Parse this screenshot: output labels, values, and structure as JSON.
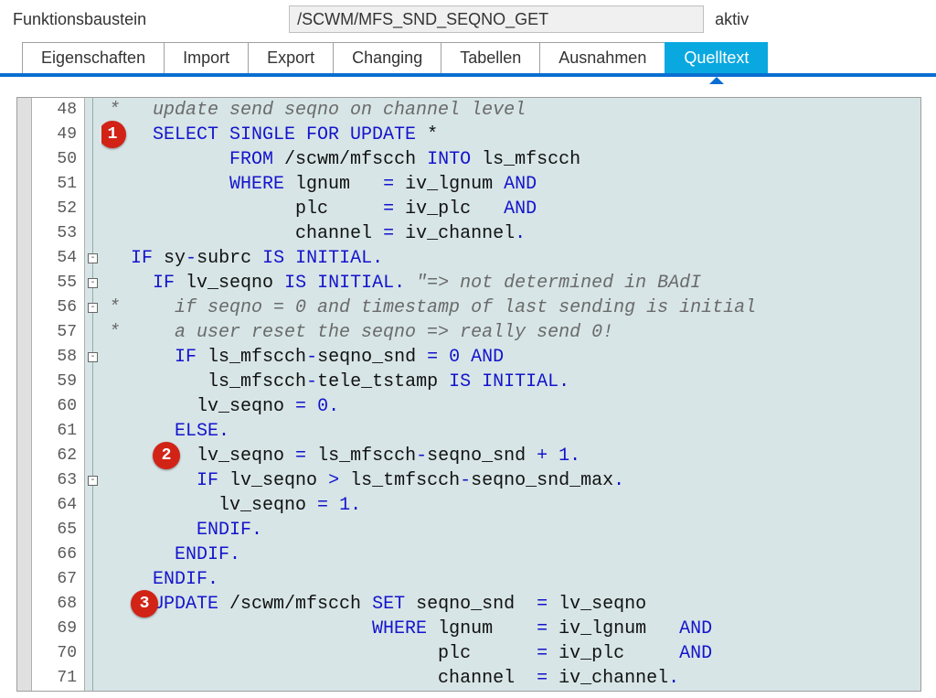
{
  "header": {
    "label": "Funktionsbaustein",
    "value": "/SCWM/MFS_SND_SEQNO_GET",
    "status": "aktiv"
  },
  "tabs": [
    {
      "label": "Eigenschaften",
      "active": false
    },
    {
      "label": "Import",
      "active": false
    },
    {
      "label": "Export",
      "active": false
    },
    {
      "label": "Changing",
      "active": false
    },
    {
      "label": "Tabellen",
      "active": false
    },
    {
      "label": "Ausnahmen",
      "active": false
    },
    {
      "label": "Quelltext",
      "active": true
    }
  ],
  "lines": [
    48,
    49,
    50,
    51,
    52,
    53,
    54,
    55,
    56,
    57,
    58,
    59,
    60,
    61,
    62,
    63,
    64,
    65,
    66,
    67,
    68,
    69,
    70,
    71
  ],
  "badges": [
    {
      "n": "1",
      "line": 49,
      "x": -3
    },
    {
      "n": "2",
      "line": 62,
      "x": 56
    },
    {
      "n": "3",
      "line": 68,
      "x": 32
    }
  ],
  "fold_glyphs": [
    {
      "line": 54,
      "sym": "⊟"
    },
    {
      "line": 55,
      "sym": "⊟"
    },
    {
      "line": 56,
      "sym": "⊟"
    },
    {
      "line": 58,
      "sym": "⊟"
    },
    {
      "line": 63,
      "sym": "⊟"
    }
  ],
  "code": [
    {
      "i": 48,
      "html": "<span class='cm'>*   update send seqno on channel level</span>"
    },
    {
      "i": 49,
      "html": "    <span class='kw'>SELECT SINGLE FOR UPDATE</span> *"
    },
    {
      "i": 50,
      "html": "           <span class='kw'>FROM</span> /scwm/mfscch <span class='kw'>INTO</span> ls_mfscch"
    },
    {
      "i": 51,
      "html": "           <span class='kw'>WHERE</span> lgnum   <span class='kw'>=</span> iv_lgnum <span class='kw'>AND</span>"
    },
    {
      "i": 52,
      "html": "                 plc     <span class='kw'>=</span> iv_plc   <span class='kw'>AND</span>"
    },
    {
      "i": 53,
      "html": "                 channel <span class='kw'>=</span> iv_channel<span class='kw'>.</span>"
    },
    {
      "i": 54,
      "html": "  <span class='kw'>IF</span> sy<span class='kw'>-</span>subrc <span class='kw'>IS INITIAL.</span>"
    },
    {
      "i": 55,
      "html": "    <span class='kw'>IF</span> lv_seqno <span class='kw'>IS INITIAL.</span> <span class='str'>\"=> not determined in BAdI</span>"
    },
    {
      "i": 56,
      "html": "<span class='cm'>*     if seqno = 0 and timestamp of last sending is initial</span>"
    },
    {
      "i": 57,
      "html": "<span class='cm'>*     a user reset the seqno => really send 0!</span>"
    },
    {
      "i": 58,
      "html": "      <span class='kw'>IF</span> ls_mfscch<span class='kw'>-</span>seqno_snd <span class='kw'>=</span> <span class='kw'>0</span> <span class='kw'>AND</span>"
    },
    {
      "i": 59,
      "html": "         ls_mfscch<span class='kw'>-</span>tele_tstamp <span class='kw'>IS INITIAL.</span>"
    },
    {
      "i": 60,
      "html": "        lv_seqno <span class='kw'>=</span> <span class='kw'>0.</span>"
    },
    {
      "i": 61,
      "html": "      <span class='kw'>ELSE.</span>"
    },
    {
      "i": 62,
      "html": "        lv_seqno <span class='kw'>=</span> ls_mfscch<span class='kw'>-</span>seqno_snd <span class='kw'>+</span> <span class='kw'>1.</span>"
    },
    {
      "i": 63,
      "html": "        <span class='kw'>IF</span> lv_seqno <span class='kw'>&gt;</span> ls_tmfscch<span class='kw'>-</span>seqno_snd_max<span class='kw'>.</span>"
    },
    {
      "i": 64,
      "html": "          lv_seqno <span class='kw'>=</span> <span class='kw'>1.</span>"
    },
    {
      "i": 65,
      "html": "        <span class='kw'>ENDIF.</span>"
    },
    {
      "i": 66,
      "html": "      <span class='kw'>ENDIF.</span>"
    },
    {
      "i": 67,
      "html": "    <span class='kw'>ENDIF.</span>"
    },
    {
      "i": 68,
      "html": "    <span class='kw'>UPDATE</span> /scwm/mfscch <span class='kw'>SET</span> seqno_snd  <span class='kw'>=</span> lv_seqno"
    },
    {
      "i": 69,
      "html": "                        <span class='kw'>WHERE</span> lgnum    <span class='kw'>=</span> iv_lgnum   <span class='kw'>AND</span>"
    },
    {
      "i": 70,
      "html": "                              plc      <span class='kw'>=</span> iv_plc     <span class='kw'>AND</span>"
    },
    {
      "i": 71,
      "html": "                              channel  <span class='kw'>=</span> iv_channel<span class='kw'>.</span>"
    }
  ]
}
